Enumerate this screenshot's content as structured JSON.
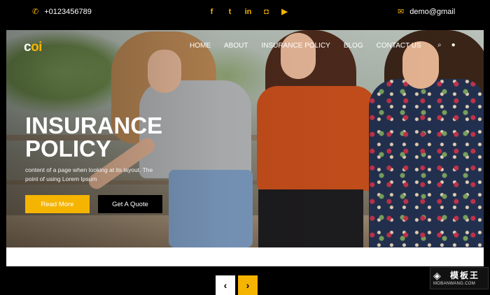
{
  "topbar": {
    "phone": "+0123456789",
    "email": "demo@gmail",
    "social": [
      {
        "name": "facebook-icon",
        "glyph": "f"
      },
      {
        "name": "twitter-icon",
        "glyph": "t"
      },
      {
        "name": "linkedin-icon",
        "glyph": "in"
      },
      {
        "name": "instagram-icon",
        "glyph": "◘"
      },
      {
        "name": "youtube-icon",
        "glyph": "▶"
      }
    ]
  },
  "header": {
    "logo_a": "c",
    "logo_b": "oi",
    "nav": [
      "HOME",
      "ABOUT",
      "INSURANCE POLICY",
      "BLOG",
      "CONTACT US"
    ],
    "search_icon": "⌕",
    "user_icon": "●"
  },
  "hero": {
    "title_line1": "INSURANCE",
    "title_line2": "POLICY",
    "description": "content of a page when looking at its layout. The point of using Lorem Ipsum",
    "read_more": "Read More",
    "get_quote": "Get A Quote"
  },
  "slider": {
    "prev": "‹",
    "next": "›"
  },
  "watermark": {
    "title": "模板王",
    "url": "MOBANWANG.COM"
  },
  "colors": {
    "accent": "#f5b400",
    "background": "#000000"
  }
}
